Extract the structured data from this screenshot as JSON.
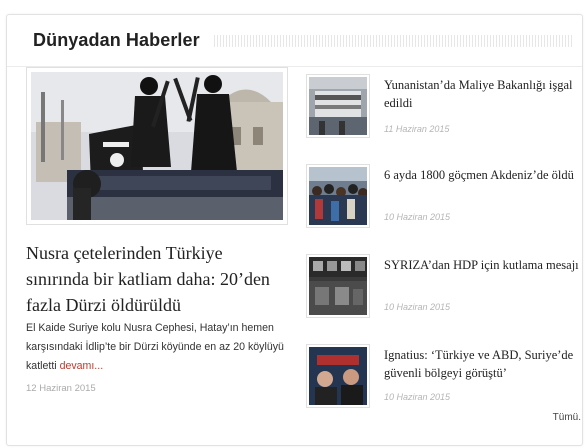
{
  "widget": {
    "title": "Dünyadan Haberler",
    "all_link": "Tümü."
  },
  "featured": {
    "title": "Nusra çetelerinden Türkiye sınırında bir katliam daha: 20’den fazla Dürzi öldürüldü",
    "description": "El Kaide Suriye kolu Nusra Cephesi, Hatay’ın hemen karşısındaki İdlip’te bir Dürzi köyünde en az 20 köylüyü katletti ",
    "more_label": "devamı...",
    "date": "12 Haziran 2015"
  },
  "items": [
    {
      "title": "Yunanistan’da Maliye Bakanlığı işgal edildi",
      "date": "11 Haziran 2015"
    },
    {
      "title": "6 ayda 1800 göçmen Akdeniz’de öldü",
      "date": "10 Haziran 2015"
    },
    {
      "title": "SYRIZA’dan HDP için kutlama mesajı",
      "date": "10 Haziran 2015"
    },
    {
      "title": "Ignatius: ‘Türkiye ve ABD, Suriye’de güvenli bölgeyi görüştü’",
      "date": "10 Haziran 2015"
    }
  ],
  "colors": {
    "accent_link": "#c0392b",
    "date_gray": "#b5b5b5",
    "border": "#e2e2e2"
  }
}
